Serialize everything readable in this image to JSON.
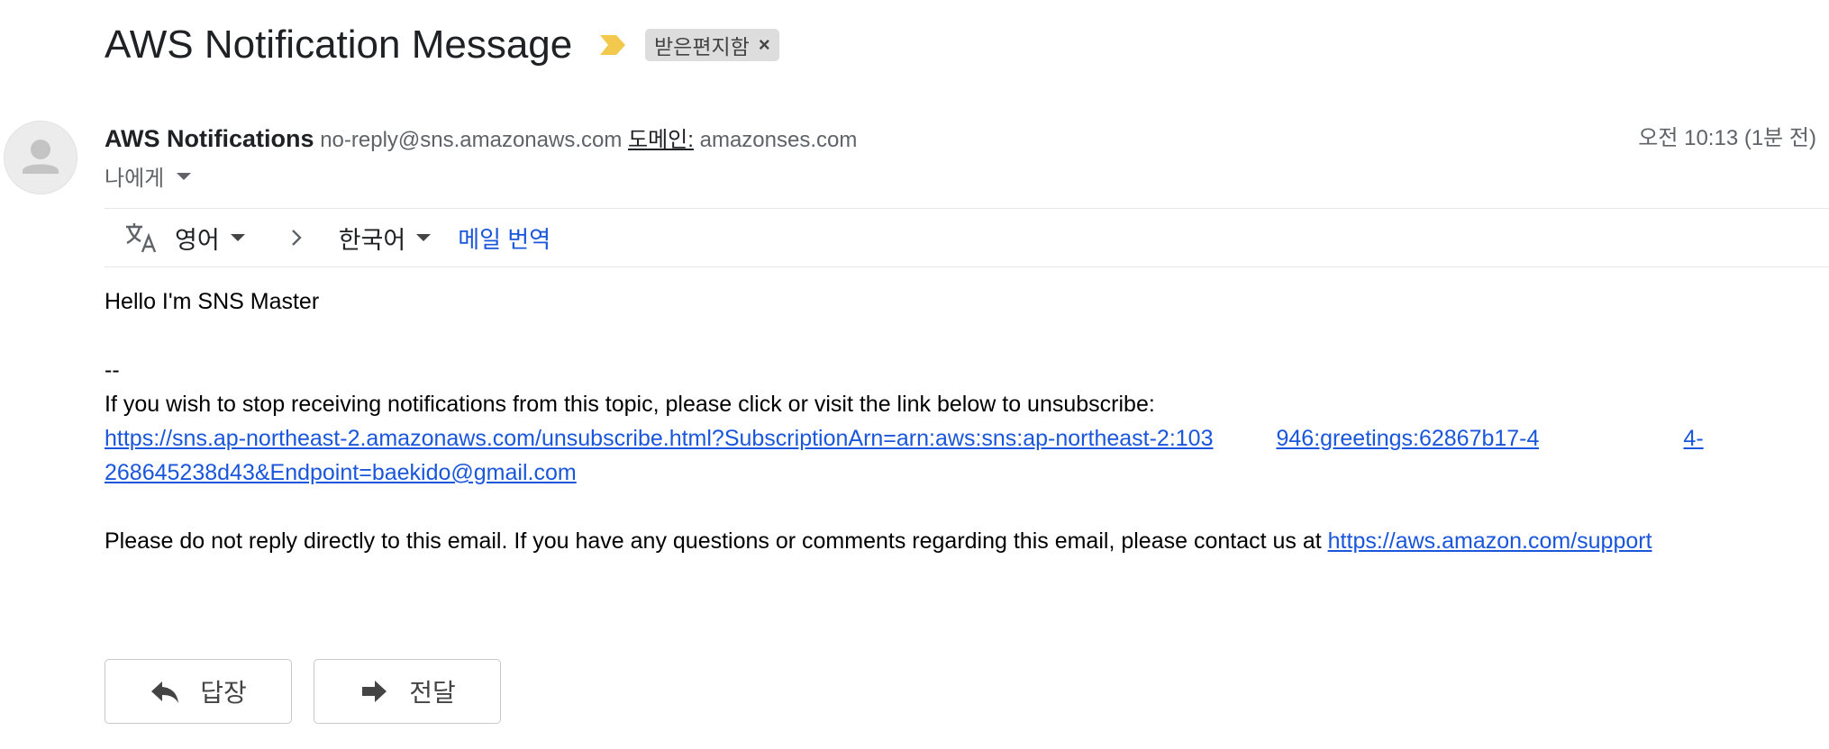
{
  "subject": "AWS Notification Message",
  "label": {
    "text": "받은편지함",
    "remove": "×"
  },
  "sender": {
    "name": "AWS Notifications",
    "email": "no-reply@sns.amazonaws.com",
    "domain_label": "도메인:",
    "domain": "amazonses.com"
  },
  "recipient": "나에게",
  "date": "오전 10:13 (1분 전)",
  "translate": {
    "from": "영어",
    "to": "한국어",
    "action": "메일 번역"
  },
  "body": {
    "greeting": "Hello I'm SNS Master",
    "separator": "--",
    "unsubscribe_text": "If you wish to stop receiving notifications from this topic, please click or visit the link below to unsubscribe:",
    "unsubscribe_link_1a": "https://sns.ap-northeast-2.amazonaws.com/unsubscribe.html?SubscriptionArn=arn:aws:sns:ap-northeast-2:103",
    "unsubscribe_link_1b": "946:greetings:62867b17-4",
    "unsubscribe_link_1c": "4-",
    "unsubscribe_link_2": "268645238d43&Endpoint=baekido@gmail.com",
    "footer_text": "Please do not reply directly to this email. If you have any questions or comments regarding this email, please contact us at ",
    "support_link": "https://aws.amazon.com/support"
  },
  "actions": {
    "reply": "답장",
    "forward": "전달"
  },
  "icons": {
    "importance": "importance-marker-icon",
    "translate": "translate-icon",
    "avatar": "default-avatar-icon",
    "reply": "reply-arrow-icon",
    "forward": "forward-arrow-icon"
  },
  "colors": {
    "link": "#1a56db",
    "importance": "#f2c94c",
    "chip_bg": "#dddddd"
  }
}
